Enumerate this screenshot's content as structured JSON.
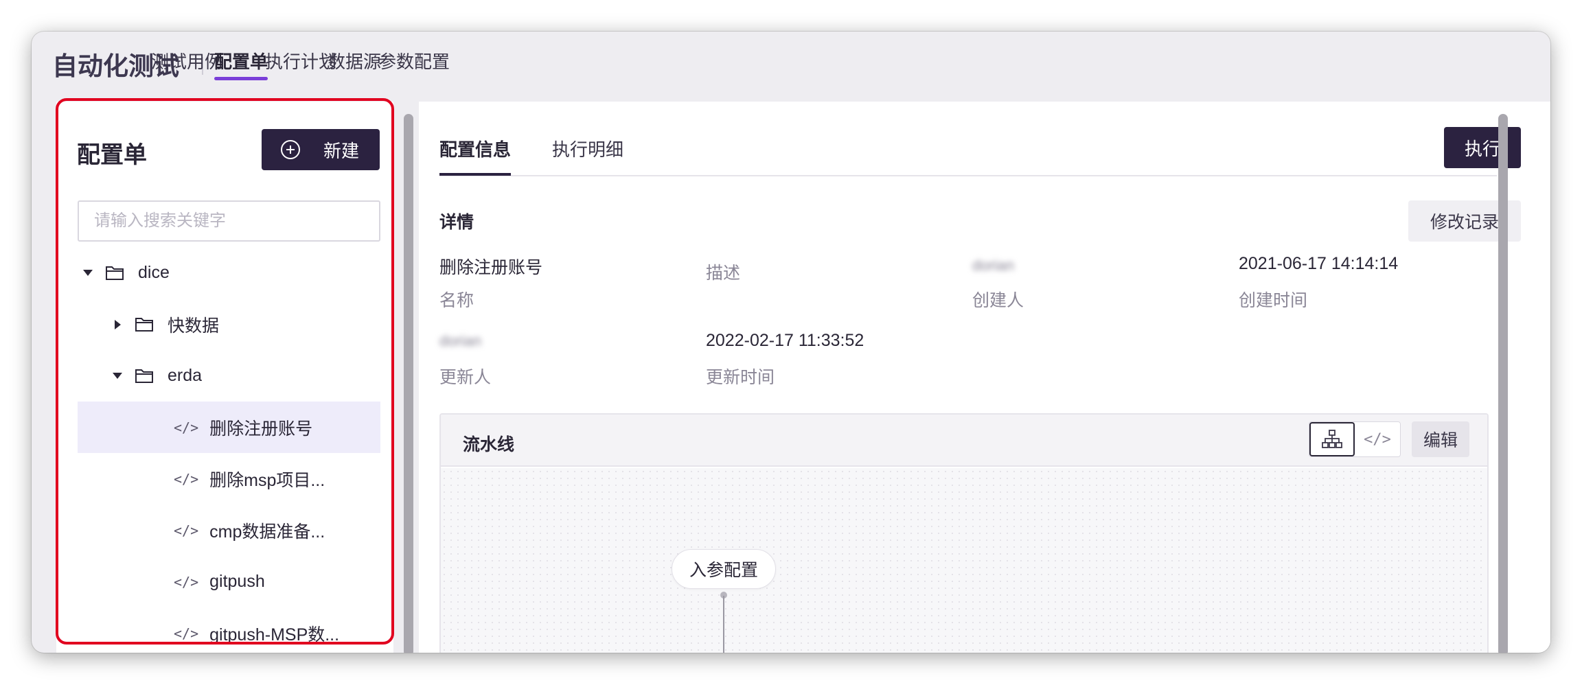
{
  "app": {
    "title": "自动化测试"
  },
  "nav": {
    "tabs": [
      "测试用例",
      "配置单",
      "执行计划",
      "数据源",
      "参数配置"
    ],
    "active_tab": "配置单"
  },
  "sidebar": {
    "title": "配置单",
    "new_button": "新建",
    "search_placeholder": "请输入搜索关键字",
    "tree": [
      {
        "label": "dice",
        "type": "folder",
        "expanded": true
      },
      {
        "label": "快数据",
        "type": "folder",
        "expanded": false
      },
      {
        "label": "erda",
        "type": "folder",
        "expanded": true
      },
      {
        "label": "删除注册账号",
        "type": "config",
        "selected": true
      },
      {
        "label": "删除msp项目...",
        "type": "config"
      },
      {
        "label": "cmp数据准备...",
        "type": "config"
      },
      {
        "label": "gitpush",
        "type": "config"
      },
      {
        "label": "gitpush-MSP数...",
        "type": "config"
      }
    ]
  },
  "main": {
    "tabs": [
      "配置信息",
      "执行明细"
    ],
    "active_tab": "配置信息",
    "run_button": "执行",
    "details": {
      "title": "详情",
      "history_button": "修改记录",
      "name_value": "删除注册账号",
      "name_label": "名称",
      "desc_label": "描述",
      "creator_value": "dorian",
      "creator_label": "创建人",
      "created_value": "2021-06-17 14:14:14",
      "created_label": "创建时间",
      "updater_value": "dorian",
      "updater_label": "更新人",
      "updated_value": "2022-02-17 11:33:52",
      "updated_label": "更新时间"
    },
    "pipeline": {
      "title": "流水线",
      "edit_button": "编辑",
      "view_modes": [
        "diagram-icon",
        "code-icon"
      ],
      "active_view": "diagram-icon",
      "node_label": "入参配置"
    }
  },
  "colors": {
    "accent": "#7a3fd8",
    "primary_button": "#2b2240",
    "highlight_border": "#e1001f",
    "selected_row": "#eeecfa"
  }
}
